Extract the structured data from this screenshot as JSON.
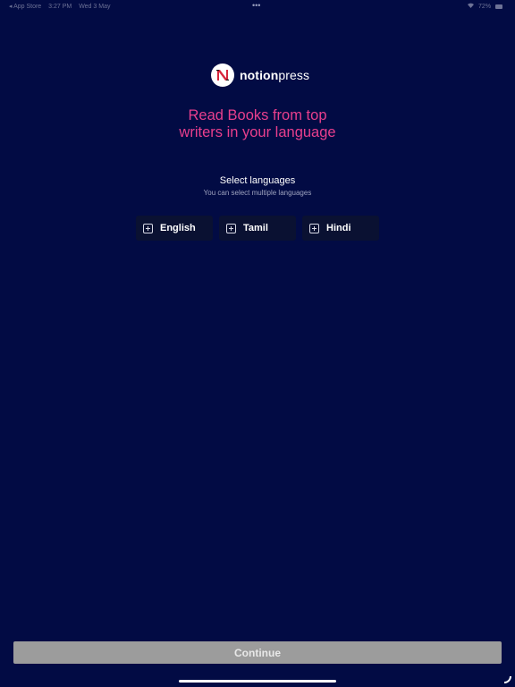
{
  "status_bar": {
    "back_app": "◂ App Store",
    "time": "3:27 PM",
    "date": "Wed 3 May",
    "more_dots": "•••",
    "battery": "72%"
  },
  "logo": {
    "mark_letter": "N",
    "brand_strong": "notion",
    "brand_light": "press"
  },
  "headline": "Read Books from top writers in your language",
  "select": {
    "title": "Select languages",
    "subtitle": "You can select multiple languages"
  },
  "languages": [
    {
      "label": "English"
    },
    {
      "label": "Tamil"
    },
    {
      "label": "Hindi"
    }
  ],
  "continue_label": "Continue",
  "colors": {
    "background": "#020b44",
    "accent": "#e93f8d",
    "chip_bg": "#0a1132",
    "button_disabled": "#9c9c9c",
    "logo_red": "#d7263d"
  }
}
